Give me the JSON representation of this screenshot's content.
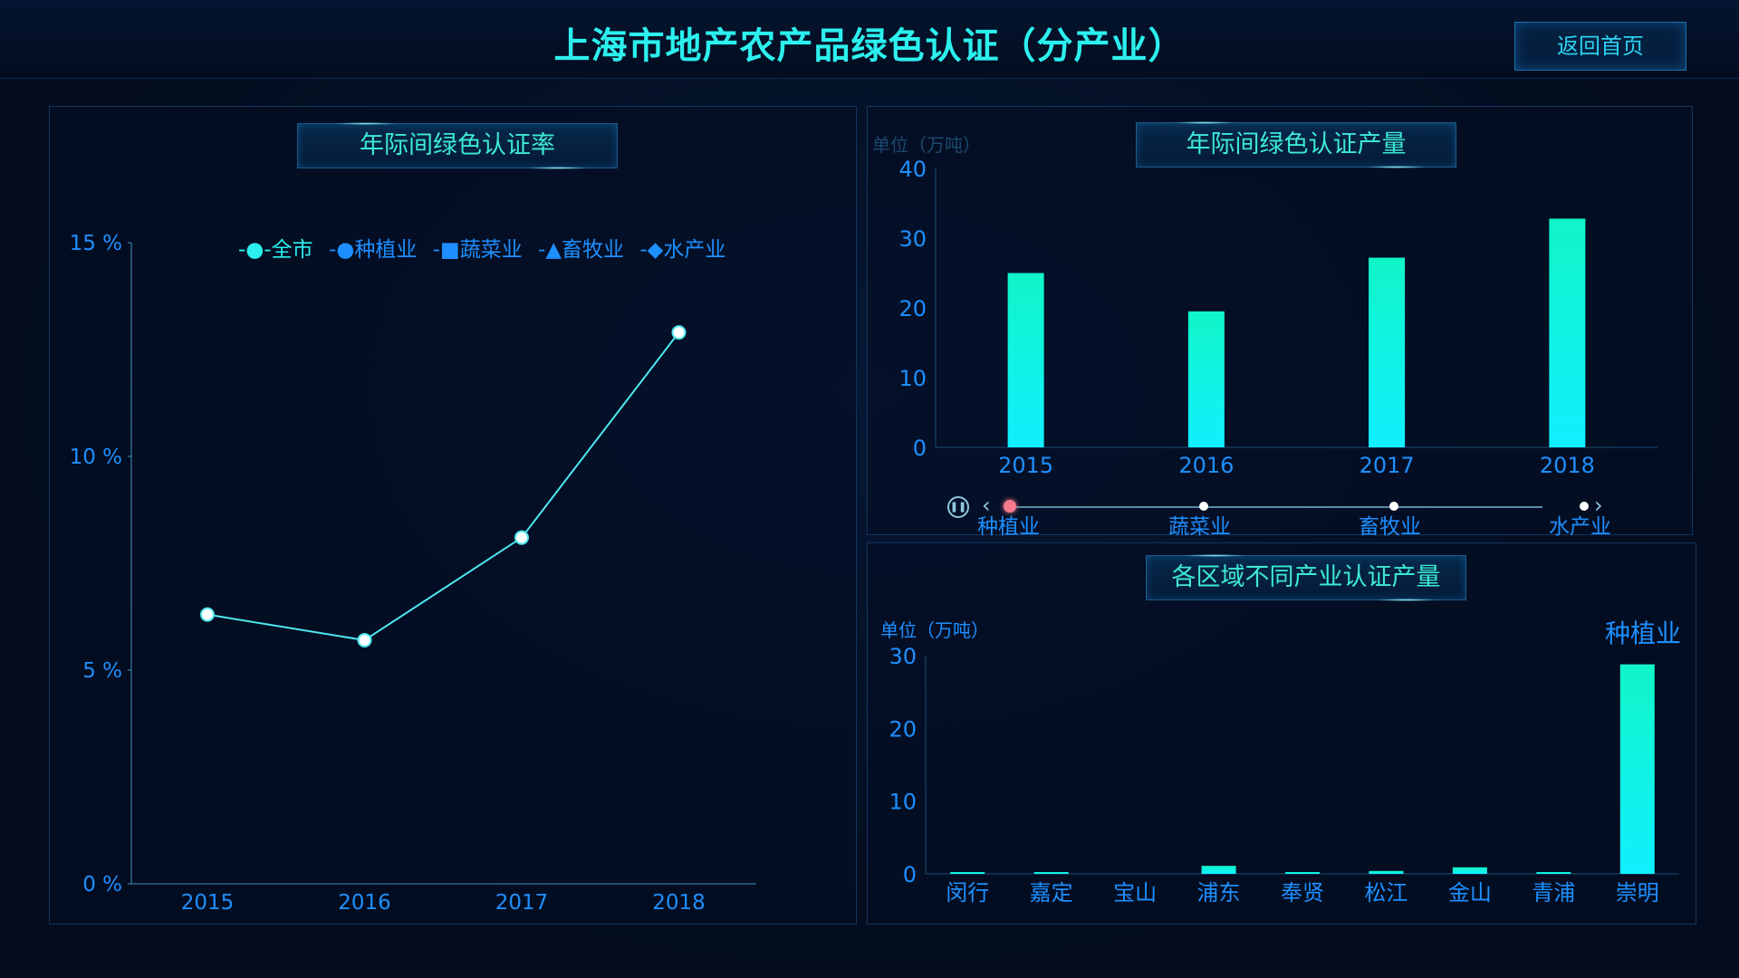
{
  "header": {
    "title": "上海市地产农产品绿色认证（分产业）",
    "back_label": "返回首页"
  },
  "colors": {
    "accent": "#2cf0ee",
    "axis_text": "#1e8fff",
    "bar_top": "#10f5c8",
    "bar_bottom": "#10f0ff",
    "line": "#4ee8f0",
    "timeline_active": "#f47a8c"
  },
  "rate_panel": {
    "title": "年际间绿色认证率",
    "legend": [
      {
        "label": "全市",
        "icon": "circle-icon",
        "active": true
      },
      {
        "label": "种植业",
        "icon": "circle-icon",
        "active": false
      },
      {
        "label": "蔬菜业",
        "icon": "square-icon",
        "active": false
      },
      {
        "label": "畜牧业",
        "icon": "triangle-icon",
        "active": false
      },
      {
        "label": "水产业",
        "icon": "diamond-icon",
        "active": false
      }
    ]
  },
  "output_panel": {
    "title": "年际间绿色认证产量",
    "unit": "单位（万吨）",
    "timeline": [
      "种植业",
      "蔬菜业",
      "畜牧业",
      "水产业"
    ],
    "timeline_active_index": 0,
    "play_icon": "pause-icon",
    "prev_icon": "chevron-left-icon",
    "next_icon": "chevron-right-icon"
  },
  "region_panel": {
    "title": "各区域不同产业认证产量",
    "unit": "单位（万吨）",
    "industry": "种植业"
  },
  "chart_data": [
    {
      "type": "line",
      "x": [
        "2015",
        "2016",
        "2017",
        "2018"
      ],
      "series": [
        {
          "name": "全市",
          "values": [
            6.3,
            5.7,
            8.1,
            12.9
          ]
        }
      ],
      "yticks": [
        "0 %",
        "5 %",
        "10 %",
        "15 %"
      ],
      "ylim": [
        0,
        15
      ],
      "legend_position": "top"
    },
    {
      "type": "bar",
      "categories": [
        "2015",
        "2016",
        "2017",
        "2018"
      ],
      "values": [
        25,
        19.5,
        27.2,
        32.8
      ],
      "yticks": [
        "0",
        "10",
        "20",
        "30",
        "40"
      ],
      "ylim": [
        0,
        40
      ]
    },
    {
      "type": "bar",
      "categories": [
        "闵行",
        "嘉定",
        "宝山",
        "浦东",
        "奉贤",
        "松江",
        "金山",
        "青浦",
        "崇明"
      ],
      "values": [
        0.15,
        0.15,
        0,
        1.1,
        0.15,
        0.4,
        0.9,
        0.15,
        28.8
      ],
      "yticks": [
        "0",
        "10",
        "20",
        "30"
      ],
      "ylim": [
        0,
        30
      ]
    }
  ]
}
